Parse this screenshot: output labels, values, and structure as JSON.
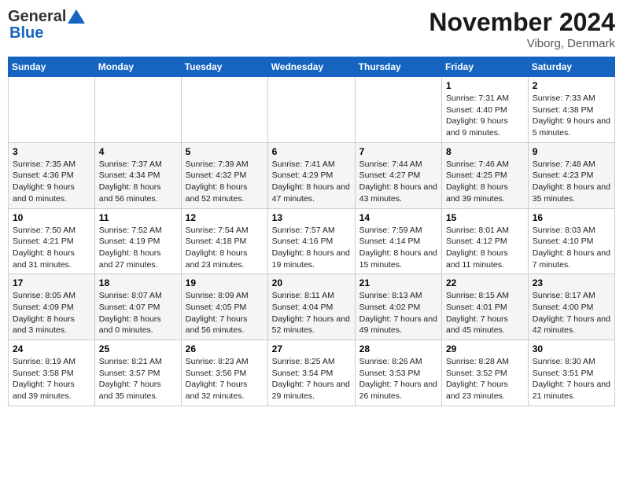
{
  "header": {
    "logo_general": "General",
    "logo_blue": "Blue",
    "month_title": "November 2024",
    "location": "Viborg, Denmark"
  },
  "days_of_week": [
    "Sunday",
    "Monday",
    "Tuesday",
    "Wednesday",
    "Thursday",
    "Friday",
    "Saturday"
  ],
  "weeks": [
    [
      {
        "day": "",
        "info": ""
      },
      {
        "day": "",
        "info": ""
      },
      {
        "day": "",
        "info": ""
      },
      {
        "day": "",
        "info": ""
      },
      {
        "day": "",
        "info": ""
      },
      {
        "day": "1",
        "info": "Sunrise: 7:31 AM\nSunset: 4:40 PM\nDaylight: 9 hours and 9 minutes."
      },
      {
        "day": "2",
        "info": "Sunrise: 7:33 AM\nSunset: 4:38 PM\nDaylight: 9 hours and 5 minutes."
      }
    ],
    [
      {
        "day": "3",
        "info": "Sunrise: 7:35 AM\nSunset: 4:36 PM\nDaylight: 9 hours and 0 minutes."
      },
      {
        "day": "4",
        "info": "Sunrise: 7:37 AM\nSunset: 4:34 PM\nDaylight: 8 hours and 56 minutes."
      },
      {
        "day": "5",
        "info": "Sunrise: 7:39 AM\nSunset: 4:32 PM\nDaylight: 8 hours and 52 minutes."
      },
      {
        "day": "6",
        "info": "Sunrise: 7:41 AM\nSunset: 4:29 PM\nDaylight: 8 hours and 47 minutes."
      },
      {
        "day": "7",
        "info": "Sunrise: 7:44 AM\nSunset: 4:27 PM\nDaylight: 8 hours and 43 minutes."
      },
      {
        "day": "8",
        "info": "Sunrise: 7:46 AM\nSunset: 4:25 PM\nDaylight: 8 hours and 39 minutes."
      },
      {
        "day": "9",
        "info": "Sunrise: 7:48 AM\nSunset: 4:23 PM\nDaylight: 8 hours and 35 minutes."
      }
    ],
    [
      {
        "day": "10",
        "info": "Sunrise: 7:50 AM\nSunset: 4:21 PM\nDaylight: 8 hours and 31 minutes."
      },
      {
        "day": "11",
        "info": "Sunrise: 7:52 AM\nSunset: 4:19 PM\nDaylight: 8 hours and 27 minutes."
      },
      {
        "day": "12",
        "info": "Sunrise: 7:54 AM\nSunset: 4:18 PM\nDaylight: 8 hours and 23 minutes."
      },
      {
        "day": "13",
        "info": "Sunrise: 7:57 AM\nSunset: 4:16 PM\nDaylight: 8 hours and 19 minutes."
      },
      {
        "day": "14",
        "info": "Sunrise: 7:59 AM\nSunset: 4:14 PM\nDaylight: 8 hours and 15 minutes."
      },
      {
        "day": "15",
        "info": "Sunrise: 8:01 AM\nSunset: 4:12 PM\nDaylight: 8 hours and 11 minutes."
      },
      {
        "day": "16",
        "info": "Sunrise: 8:03 AM\nSunset: 4:10 PM\nDaylight: 8 hours and 7 minutes."
      }
    ],
    [
      {
        "day": "17",
        "info": "Sunrise: 8:05 AM\nSunset: 4:09 PM\nDaylight: 8 hours and 3 minutes."
      },
      {
        "day": "18",
        "info": "Sunrise: 8:07 AM\nSunset: 4:07 PM\nDaylight: 8 hours and 0 minutes."
      },
      {
        "day": "19",
        "info": "Sunrise: 8:09 AM\nSunset: 4:05 PM\nDaylight: 7 hours and 56 minutes."
      },
      {
        "day": "20",
        "info": "Sunrise: 8:11 AM\nSunset: 4:04 PM\nDaylight: 7 hours and 52 minutes."
      },
      {
        "day": "21",
        "info": "Sunrise: 8:13 AM\nSunset: 4:02 PM\nDaylight: 7 hours and 49 minutes."
      },
      {
        "day": "22",
        "info": "Sunrise: 8:15 AM\nSunset: 4:01 PM\nDaylight: 7 hours and 45 minutes."
      },
      {
        "day": "23",
        "info": "Sunrise: 8:17 AM\nSunset: 4:00 PM\nDaylight: 7 hours and 42 minutes."
      }
    ],
    [
      {
        "day": "24",
        "info": "Sunrise: 8:19 AM\nSunset: 3:58 PM\nDaylight: 7 hours and 39 minutes."
      },
      {
        "day": "25",
        "info": "Sunrise: 8:21 AM\nSunset: 3:57 PM\nDaylight: 7 hours and 35 minutes."
      },
      {
        "day": "26",
        "info": "Sunrise: 8:23 AM\nSunset: 3:56 PM\nDaylight: 7 hours and 32 minutes."
      },
      {
        "day": "27",
        "info": "Sunrise: 8:25 AM\nSunset: 3:54 PM\nDaylight: 7 hours and 29 minutes."
      },
      {
        "day": "28",
        "info": "Sunrise: 8:26 AM\nSunset: 3:53 PM\nDaylight: 7 hours and 26 minutes."
      },
      {
        "day": "29",
        "info": "Sunrise: 8:28 AM\nSunset: 3:52 PM\nDaylight: 7 hours and 23 minutes."
      },
      {
        "day": "30",
        "info": "Sunrise: 8:30 AM\nSunset: 3:51 PM\nDaylight: 7 hours and 21 minutes."
      }
    ]
  ]
}
